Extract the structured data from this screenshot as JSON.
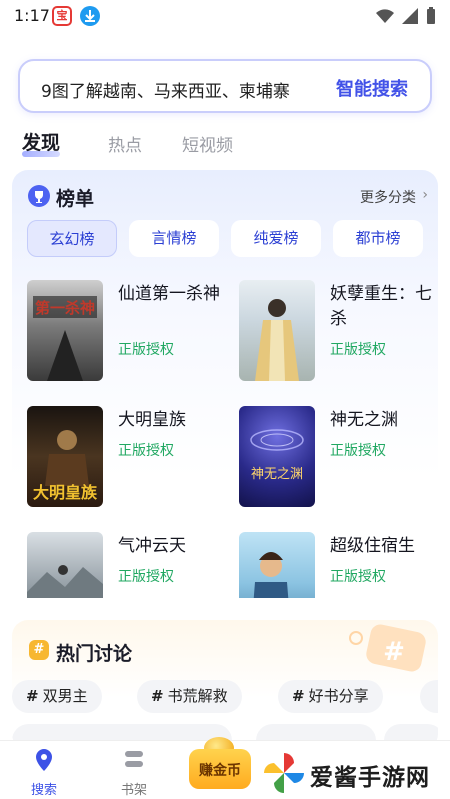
{
  "status_bar": {
    "time": "1:17",
    "app_icon_1": "宝",
    "app_icon_2": "download-icon"
  },
  "search": {
    "query": "9图了解越南、马来西亚、柬埔寨",
    "button": "智能搜索"
  },
  "top_tabs": [
    {
      "label": "发现",
      "active": true
    },
    {
      "label": "热点",
      "active": false
    },
    {
      "label": "短视频",
      "active": false
    }
  ],
  "rank": {
    "title": "榜单",
    "more": "更多分类",
    "categories": [
      {
        "label": "玄幻榜",
        "active": true
      },
      {
        "label": "言情榜",
        "active": false
      },
      {
        "label": "纯爱榜",
        "active": false
      },
      {
        "label": "都市榜",
        "active": false
      }
    ],
    "books": [
      {
        "title": "仙道第一杀神",
        "license": "正版授权"
      },
      {
        "title": "妖孽重生：七杀",
        "license": "正版授权"
      },
      {
        "title": "大明皇族",
        "license": "正版授权"
      },
      {
        "title": "神无之渊",
        "license": "正版授权"
      },
      {
        "title": "气冲云天",
        "license": "正版授权"
      },
      {
        "title": "超级住宿生",
        "license": "正版授权"
      }
    ]
  },
  "discussion": {
    "title": "热门讨论",
    "chips": [
      "双男主",
      "书荒解救",
      "好书分享"
    ]
  },
  "bottom_nav": {
    "search_label": "搜索",
    "shelf_label": "书架",
    "earn_label": "赚金币",
    "watermark": "爱酱手游网"
  },
  "colors": {
    "accent": "#4252e8",
    "license": "#21a862",
    "earn": "#ffab1f"
  }
}
